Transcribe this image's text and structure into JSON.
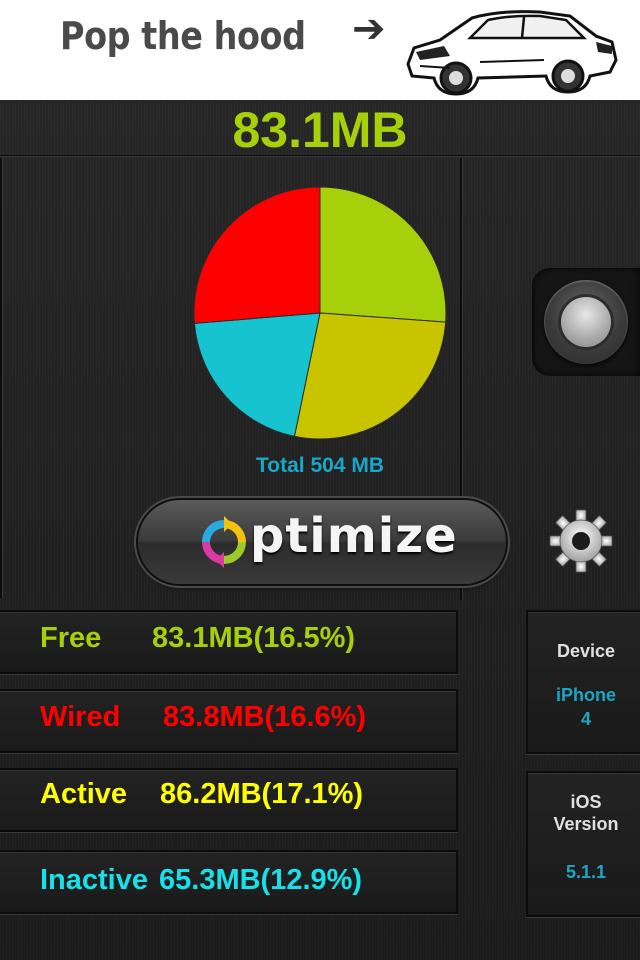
{
  "banner": {
    "text": "Pop the hood",
    "arrow": "➔",
    "image": "car-illustration"
  },
  "memory": {
    "headline": "83.1MB",
    "total_label": "Total 504 MB"
  },
  "chart_data": {
    "type": "pie",
    "slices": [
      {
        "label": "Free",
        "value": 16.5,
        "color": "#a6d10a"
      },
      {
        "label": "Inactive",
        "value": 12.9,
        "color": "#17c3cf"
      },
      {
        "label": "Wired",
        "value": 16.6,
        "color": "#ff0000"
      },
      {
        "label": "Active",
        "value": 17.1,
        "color": "#c8c400"
      }
    ]
  },
  "optimize": {
    "label": "ptimize",
    "icon": "refresh-circle-icon"
  },
  "stats": [
    {
      "label": "Free",
      "value": "83.1MB(16.5%)",
      "color": "#a6d10a"
    },
    {
      "label": "Wired",
      "value": "83.8MB(16.6%)",
      "color": "#ff0000"
    },
    {
      "label": "Active",
      "value": "86.2MB(17.1%)",
      "color": "#ffff00"
    },
    {
      "label": "Inactive",
      "value": "65.3MB(12.9%)",
      "color": "#17e0e8"
    }
  ],
  "device": {
    "title": "Device",
    "value_line1": "iPhone",
    "value_line2": "4"
  },
  "ios": {
    "title_line1": "iOS",
    "title_line2": "Version",
    "value": "5.1.1"
  },
  "icons": {
    "settings": "gear-icon",
    "assistive_touch": "home-button-icon"
  }
}
